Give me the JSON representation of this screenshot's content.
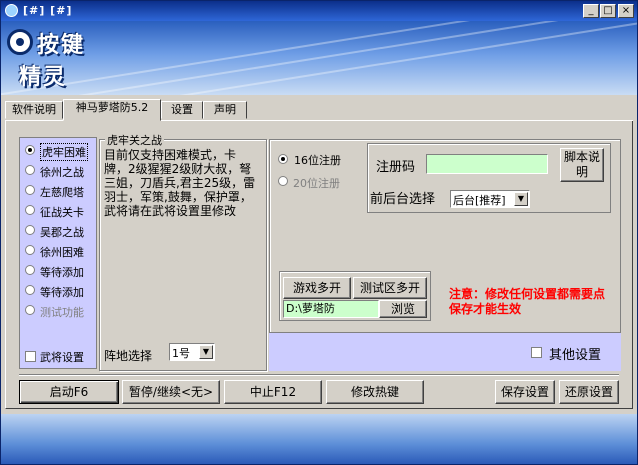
{
  "window": {
    "title": "[#]   [#]",
    "minimize_label": "_",
    "maximize_label": "□",
    "close_label": "×"
  },
  "logo": {
    "line1": "按键",
    "line2": "精灵"
  },
  "tabs": [
    {
      "label": "软件说明"
    },
    {
      "label": "神马萝塔防5.2"
    },
    {
      "label": "设置"
    },
    {
      "label": "声明"
    }
  ],
  "modes": [
    {
      "label": "虎牢困难",
      "checked": true
    },
    {
      "label": "徐州之战"
    },
    {
      "label": "左慈爬塔"
    },
    {
      "label": "征战关卡"
    },
    {
      "label": "吴郡之战"
    },
    {
      "label": "徐州困难"
    },
    {
      "label": "等待添加"
    },
    {
      "label": "等待添加"
    },
    {
      "label": "测试功能",
      "disabled": true
    }
  ],
  "general_settings_label": "武将设置",
  "group": {
    "title": "虎牢关之战",
    "description": "目前仅支持困难模式，卡牌，2级猩猩2级财大叔，弩三姐，刀盾兵,君主25级，雷羽士，军策,鼓舞，保护罩，武将请在武将设置里修改"
  },
  "formation": {
    "label": "阵地选择",
    "value": "1号"
  },
  "registration": {
    "option16": "16位注册",
    "option20": "20位注册",
    "code_label": "注册码",
    "code_value": "",
    "script_button": "脚本说明",
    "bg_label": "前后台选择",
    "bg_value": "后台[推荐]"
  },
  "multi_open": {
    "game_button": "游戏多开",
    "test_button": "测试区多开",
    "path_value": "D:\\萝塔防",
    "browse_button": "浏览"
  },
  "notice": "注意：修改任何设置都需要点保存才能生效",
  "other_settings_label": "其他设置",
  "buttons": {
    "start": "启动F6",
    "pause": "暂停/继续<无>",
    "stop": "中止F12",
    "hotkey": "修改热键",
    "save": "保存设置",
    "restore": "还原设置"
  },
  "colors": {
    "list_bg": "#ccccff",
    "notice": "#ff0000",
    "title_bar": "#0b2f8a"
  }
}
